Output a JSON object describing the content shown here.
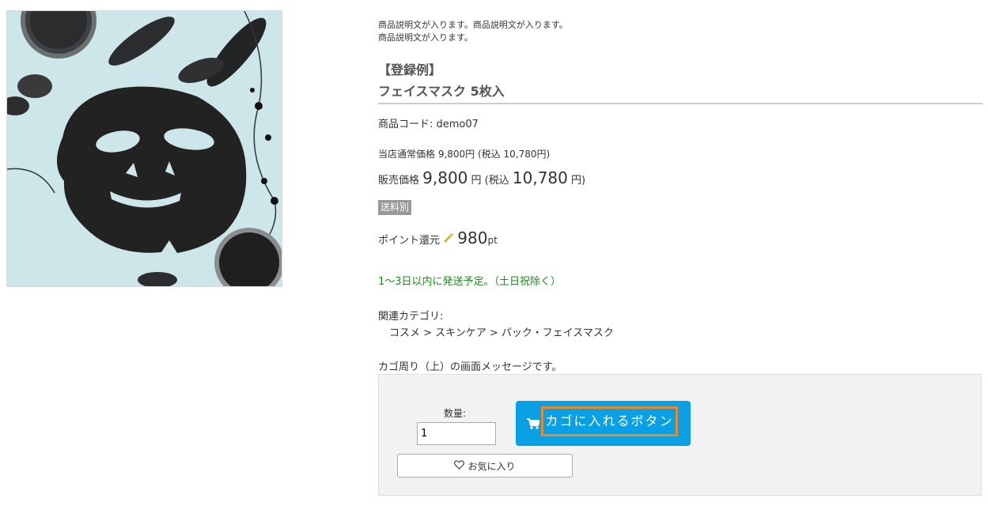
{
  "description": {
    "line1": "商品説明文が入ります。商品説明文が入ります。",
    "line2": "商品説明文が入ります。"
  },
  "product": {
    "registration_label": "【登録例】",
    "title": "フェイスマスク 5枚入",
    "code_label": "商品コード: ",
    "code": "demo07",
    "normal_price": "当店通常価格 9,800円 (税込 10,780円)",
    "sale_label": "販売価格 ",
    "sale_price": "9,800",
    "sale_yen": " 円 (税込 ",
    "sale_tax_price": "10,780",
    "sale_yen_close": " 円)",
    "shipping_badge": "送料別",
    "points_label": "ポイント還元 ",
    "points_value": "980",
    "points_unit": "pt",
    "delivery_note": "1〜3日以内に発送予定。（土日祝除く）",
    "category_label": "関連カテゴリ:",
    "category_path": "コスメ > スキンケア > パック・フェイスマスク"
  },
  "cart": {
    "message": "カゴ周り（上）の画面メッセージです。",
    "quantity_label": "数量:",
    "quantity_value": "1",
    "add_to_cart_label": "カゴに入れるボタン",
    "favorite_label": "お気に入り"
  },
  "colors": {
    "accent": "#0aa0e6",
    "delivery_green": "#1c8d1c",
    "highlight_border": "#e8892c"
  },
  "icons": [
    "cart-icon",
    "heart-icon",
    "point-wand-icon"
  ]
}
